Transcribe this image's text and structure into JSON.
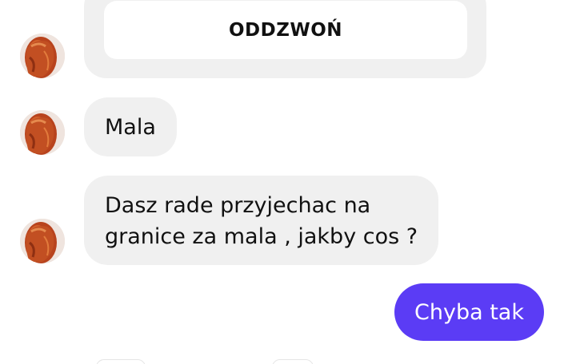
{
  "conversation": {
    "call_card": {
      "button_label": "ODDZWOŃ"
    },
    "messages": [
      {
        "direction": "incoming",
        "text": "Mala"
      },
      {
        "direction": "incoming",
        "lines": [
          "Dasz rade przyjechac na",
          "granice za mala , jakby cos ?"
        ]
      },
      {
        "direction": "outgoing",
        "text": "Chyba tak"
      }
    ],
    "contact": {
      "avatar_icon": "contact-avatar-photo"
    },
    "colors": {
      "incoming_bubble": "#f0f0f0",
      "outgoing_bubble": "#5b3cf5",
      "outgoing_text": "#ffffff",
      "incoming_text": "#111111"
    }
  }
}
